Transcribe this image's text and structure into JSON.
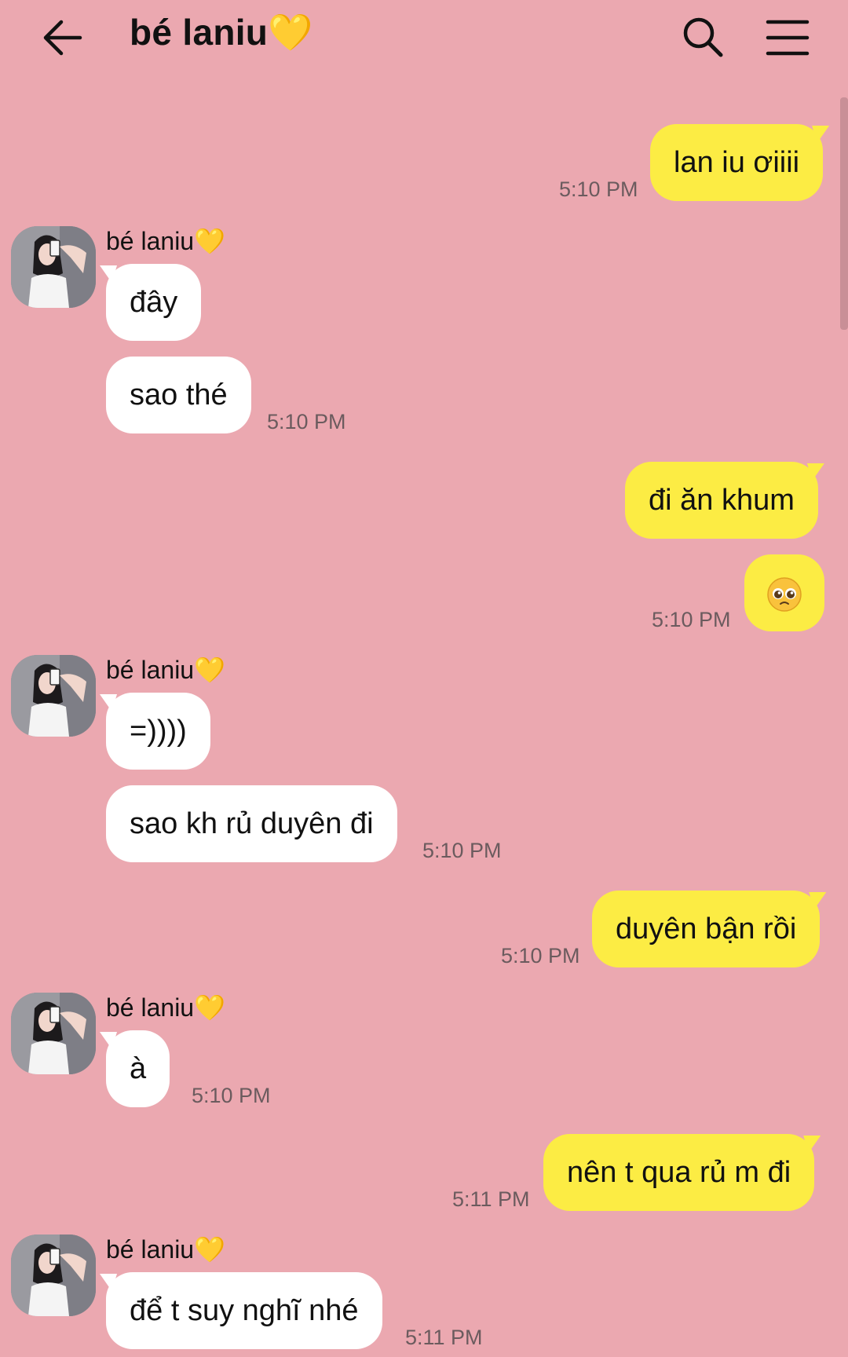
{
  "header": {
    "title": "bé laniu💛",
    "back_icon": "arrow-left-icon",
    "search_icon": "search-icon",
    "menu_icon": "menu-icon"
  },
  "colors": {
    "background": "#eba8b0",
    "my_bubble": "#fcec44",
    "their_bubble": "#ffffff",
    "timestamp": "#6b5b5e"
  },
  "messages": [
    {
      "from": "me",
      "text": "lan iu ơiiii",
      "time": "5:10 PM"
    },
    {
      "from": "them",
      "sender": "bé laniu💛",
      "text": "đây"
    },
    {
      "from": "them",
      "text": "sao thé",
      "time": "5:10 PM"
    },
    {
      "from": "me",
      "text": "đi ăn khum"
    },
    {
      "from": "me",
      "emoji": "pleading-face-icon",
      "time": "5:10 PM"
    },
    {
      "from": "them",
      "sender": "bé laniu💛",
      "text": "=))))"
    },
    {
      "from": "them",
      "text": "sao kh rủ duyên đi",
      "time": "5:10 PM"
    },
    {
      "from": "me",
      "text": "duyên bận rồi",
      "time": "5:10 PM"
    },
    {
      "from": "them",
      "sender": "bé laniu💛",
      "text": "à",
      "time": "5:10 PM"
    },
    {
      "from": "me",
      "text": "nên t qua rủ m đi",
      "time": "5:11 PM"
    },
    {
      "from": "them",
      "sender": "bé laniu💛",
      "text": "để t suy nghĩ nhé",
      "time": "5:11 PM"
    }
  ]
}
